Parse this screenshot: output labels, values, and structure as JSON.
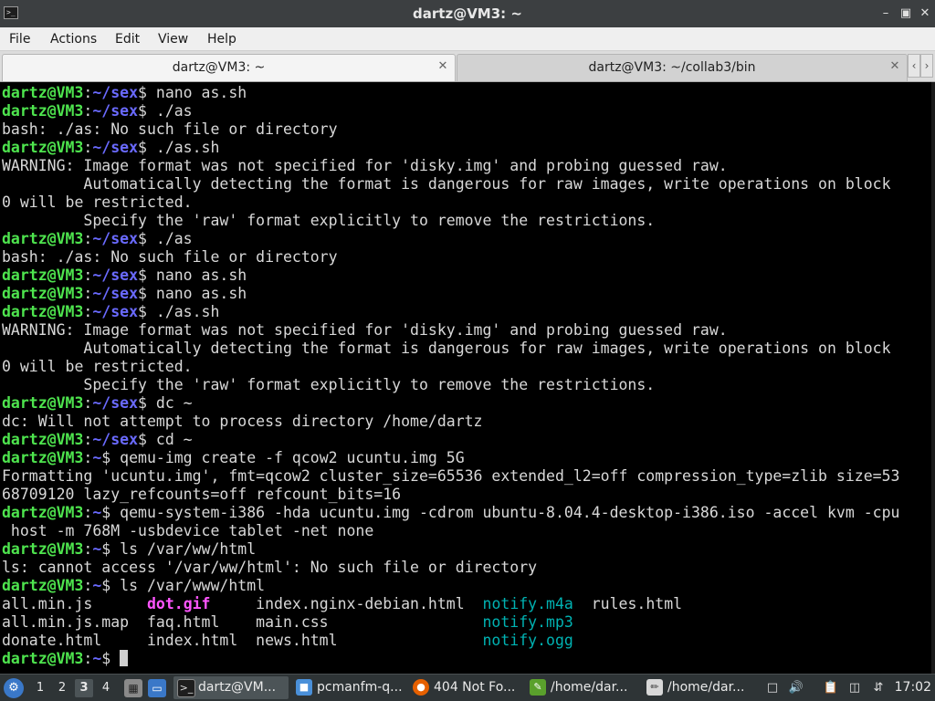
{
  "window": {
    "title": "dartz@VM3: ~"
  },
  "menu": [
    "File",
    "Actions",
    "Edit",
    "View",
    "Help"
  ],
  "tabs": [
    {
      "label": "dartz@VM3: ~",
      "active": true
    },
    {
      "label": "dartz@VM3: ~/collab3/bin",
      "active": false
    }
  ],
  "terminal": {
    "lines": [
      [
        {
          "t": "dartz@VM3",
          "c": "user"
        },
        {
          "t": ":",
          "c": ""
        },
        {
          "t": "~/sex",
          "c": "path"
        },
        {
          "t": "$ nano as.sh",
          "c": ""
        }
      ],
      [
        {
          "t": "dartz@VM3",
          "c": "user"
        },
        {
          "t": ":",
          "c": ""
        },
        {
          "t": "~/sex",
          "c": "path"
        },
        {
          "t": "$ ./as",
          "c": ""
        }
      ],
      [
        {
          "t": "bash: ./as: No such file or directory",
          "c": ""
        }
      ],
      [
        {
          "t": "dartz@VM3",
          "c": "user"
        },
        {
          "t": ":",
          "c": ""
        },
        {
          "t": "~/sex",
          "c": "path"
        },
        {
          "t": "$ ./as.sh",
          "c": ""
        }
      ],
      [
        {
          "t": "WARNING: Image format was not specified for 'disky.img' and probing guessed raw.",
          "c": ""
        }
      ],
      [
        {
          "t": "         Automatically detecting the format is dangerous for raw images, write operations on block",
          "c": ""
        }
      ],
      [
        {
          "t": "0 will be restricted.",
          "c": ""
        }
      ],
      [
        {
          "t": "         Specify the 'raw' format explicitly to remove the restrictions.",
          "c": ""
        }
      ],
      [
        {
          "t": "dartz@VM3",
          "c": "user"
        },
        {
          "t": ":",
          "c": ""
        },
        {
          "t": "~/sex",
          "c": "path"
        },
        {
          "t": "$ ./as",
          "c": ""
        }
      ],
      [
        {
          "t": "bash: ./as: No such file or directory",
          "c": ""
        }
      ],
      [
        {
          "t": "dartz@VM3",
          "c": "user"
        },
        {
          "t": ":",
          "c": ""
        },
        {
          "t": "~/sex",
          "c": "path"
        },
        {
          "t": "$ nano as.sh",
          "c": ""
        }
      ],
      [
        {
          "t": "dartz@VM3",
          "c": "user"
        },
        {
          "t": ":",
          "c": ""
        },
        {
          "t": "~/sex",
          "c": "path"
        },
        {
          "t": "$ nano as.sh",
          "c": ""
        }
      ],
      [
        {
          "t": "dartz@VM3",
          "c": "user"
        },
        {
          "t": ":",
          "c": ""
        },
        {
          "t": "~/sex",
          "c": "path"
        },
        {
          "t": "$ ./as.sh",
          "c": ""
        }
      ],
      [
        {
          "t": "WARNING: Image format was not specified for 'disky.img' and probing guessed raw.",
          "c": ""
        }
      ],
      [
        {
          "t": "         Automatically detecting the format is dangerous for raw images, write operations on block",
          "c": ""
        }
      ],
      [
        {
          "t": "0 will be restricted.",
          "c": ""
        }
      ],
      [
        {
          "t": "         Specify the 'raw' format explicitly to remove the restrictions.",
          "c": ""
        }
      ],
      [
        {
          "t": "dartz@VM3",
          "c": "user"
        },
        {
          "t": ":",
          "c": ""
        },
        {
          "t": "~/sex",
          "c": "path"
        },
        {
          "t": "$ dc ~",
          "c": ""
        }
      ],
      [
        {
          "t": "dc: Will not attempt to process directory /home/dartz",
          "c": ""
        }
      ],
      [
        {
          "t": "dartz@VM3",
          "c": "user"
        },
        {
          "t": ":",
          "c": ""
        },
        {
          "t": "~/sex",
          "c": "path"
        },
        {
          "t": "$ cd ~",
          "c": ""
        }
      ],
      [
        {
          "t": "dartz@VM3",
          "c": "user"
        },
        {
          "t": ":",
          "c": ""
        },
        {
          "t": "~",
          "c": "path"
        },
        {
          "t": "$ qemu-img create -f qcow2 ucuntu.img 5G",
          "c": ""
        }
      ],
      [
        {
          "t": "Formatting 'ucuntu.img', fmt=qcow2 cluster_size=65536 extended_l2=off compression_type=zlib size=53",
          "c": ""
        }
      ],
      [
        {
          "t": "68709120 lazy_refcounts=off refcount_bits=16",
          "c": ""
        }
      ],
      [
        {
          "t": "dartz@VM3",
          "c": "user"
        },
        {
          "t": ":",
          "c": ""
        },
        {
          "t": "~",
          "c": "path"
        },
        {
          "t": "$ qemu-system-i386 -hda ucuntu.img -cdrom ubuntu-8.04.4-desktop-i386.iso -accel kvm -cpu",
          "c": ""
        }
      ],
      [
        {
          "t": " host -m 768M -usbdevice tablet -net none",
          "c": ""
        }
      ],
      [
        {
          "t": "dartz@VM3",
          "c": "user"
        },
        {
          "t": ":",
          "c": ""
        },
        {
          "t": "~",
          "c": "path"
        },
        {
          "t": "$ ls /var/ww/html",
          "c": ""
        }
      ],
      [
        {
          "t": "ls: cannot access '/var/ww/html': No such file or directory",
          "c": ""
        }
      ],
      [
        {
          "t": "dartz@VM3",
          "c": "user"
        },
        {
          "t": ":",
          "c": ""
        },
        {
          "t": "~",
          "c": "path"
        },
        {
          "t": "$ ls /var/www/html",
          "c": ""
        }
      ],
      [
        {
          "t": "all.min.js      ",
          "c": ""
        },
        {
          "t": "dot.gif",
          "c": "gif"
        },
        {
          "t": "     index.nginx-debian.html  ",
          "c": ""
        },
        {
          "t": "notify.m4a",
          "c": "audio"
        },
        {
          "t": "  rules.html",
          "c": ""
        }
      ],
      [
        {
          "t": "all.min.js.map  faq.html    main.css                 ",
          "c": ""
        },
        {
          "t": "notify.mp3",
          "c": "audio"
        }
      ],
      [
        {
          "t": "donate.html     index.html  news.html                ",
          "c": ""
        },
        {
          "t": "notify.ogg",
          "c": "audio"
        }
      ],
      [
        {
          "t": "dartz@VM3",
          "c": "user"
        },
        {
          "t": ":",
          "c": ""
        },
        {
          "t": "~",
          "c": "path"
        },
        {
          "t": "$ ",
          "c": ""
        }
      ]
    ]
  },
  "taskbar": {
    "workspaces": [
      "1",
      "2",
      "3",
      "4"
    ],
    "current_workspace": "3",
    "tasks": [
      {
        "label": "dartz@VM...",
        "icon": "terminal-icon",
        "active": true
      },
      {
        "label": "pcmanfm-q...",
        "icon": "folder-icon",
        "active": false
      },
      {
        "label": "404 Not Fo...",
        "icon": "firefox-icon",
        "active": false
      },
      {
        "label": "/home/dar...",
        "icon": "text-editor-icon",
        "active": false
      },
      {
        "label": "/home/dar...",
        "icon": "notepad-icon",
        "active": false
      }
    ],
    "clock": "17:02"
  }
}
